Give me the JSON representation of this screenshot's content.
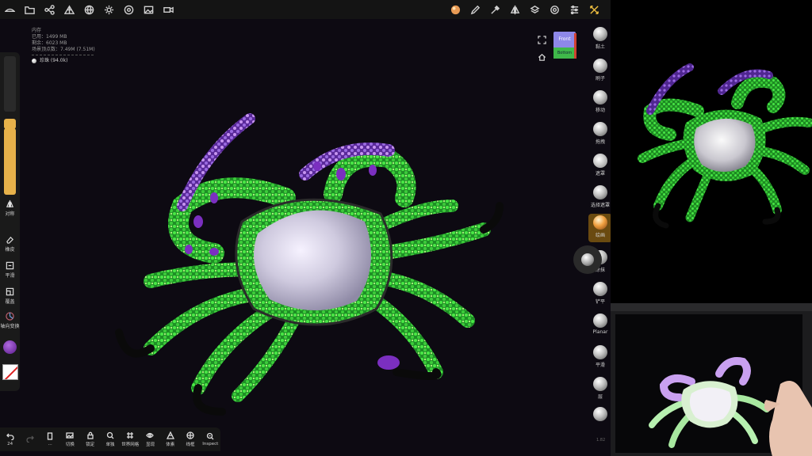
{
  "stats": {
    "title": "内存",
    "used": "已用：1499 MB",
    "free": "剩余：6023 MB",
    "vertices": "场景顶点数：7.49M (7.51M)",
    "object": "珍珠 (94.0k)"
  },
  "left_panel": {
    "symmetry": "对称",
    "eraser": "橡皮",
    "smooth": "平滑",
    "mask": "覆盖",
    "axis": "轴向变换"
  },
  "nav_cube": {
    "front": "Front",
    "bottom": "Bottom"
  },
  "tools": [
    {
      "label": "黏土"
    },
    {
      "label": "刷子"
    },
    {
      "label": "移动"
    },
    {
      "label": "拖拽"
    },
    {
      "label": "遮罩"
    },
    {
      "label": "选择遮罩"
    },
    {
      "label": "绘画"
    },
    {
      "label": "涂抹"
    },
    {
      "label": "铲平"
    },
    {
      "label": "Planar"
    },
    {
      "label": "平滑"
    },
    {
      "label": "层"
    }
  ],
  "bottom_bar": [
    {
      "label": "24",
      "icon": "undo-icon"
    },
    {
      "label": "",
      "icon": "redo-icon"
    },
    {
      "label": "...",
      "icon": "phone-icon"
    },
    {
      "label": "切换",
      "icon": "image-icon"
    },
    {
      "label": "锁定",
      "icon": "lock-icon"
    },
    {
      "label": "单独",
      "icon": "search-icon"
    },
    {
      "label": "世界网格",
      "icon": "grid-icon"
    },
    {
      "label": "显现",
      "icon": "eye-icon"
    },
    {
      "label": "体素",
      "icon": "voxel-icon"
    },
    {
      "label": "线框",
      "icon": "wireframe-icon"
    },
    {
      "label": "Inspect",
      "icon": "inspect-icon"
    }
  ],
  "version": "1.82",
  "colors": {
    "accent": "#e7b24a",
    "pearl": "#dcd8e8",
    "gem_green": "#39d23a",
    "gem_purple": "#7b2fc0"
  }
}
